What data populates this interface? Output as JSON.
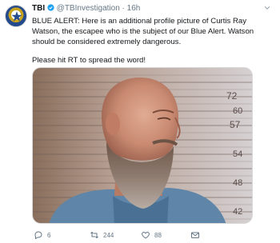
{
  "tweet": {
    "display_name": "TBI",
    "handle": "@TBInvestigation",
    "separator": "·",
    "time": "16h",
    "text_1": "BLUE ALERT: Here is an additional profile picture of Curtis Ray Watson, the escapee who is the subject of our Blue Alert. Watson should be considered extremely dangerous.",
    "text_2": "Please hit RT to spread the word!",
    "ruler_marks": [
      "72",
      "60",
      "57",
      "54",
      "48",
      "42"
    ]
  },
  "actions": {
    "reply_count": "6",
    "retweet_count": "244",
    "like_count": "88"
  },
  "colors": {
    "name": "#14171a",
    "meta": "#657786",
    "avatar_blue": "#234a8c",
    "avatar_gold": "#c6a21f"
  }
}
